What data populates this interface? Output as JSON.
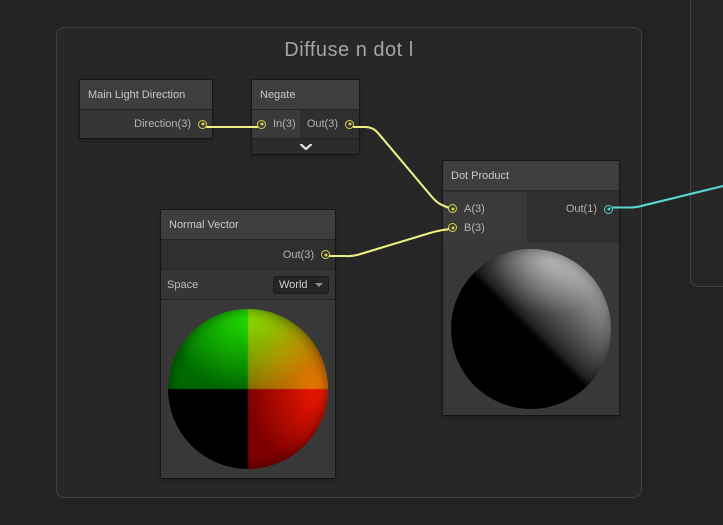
{
  "group": {
    "title": "Diffuse n dot l"
  },
  "nodes": {
    "main_light_direction": {
      "title": "Main Light Direction",
      "output_label": "Direction(3)"
    },
    "negate": {
      "title": "Negate",
      "input_label": "In(3)",
      "output_label": "Out(3)"
    },
    "normal_vector": {
      "title": "Normal Vector",
      "output_label": "Out(3)",
      "space_label": "Space",
      "space_value": "World"
    },
    "dot_product": {
      "title": "Dot Product",
      "input_a_label": "A(3)",
      "input_b_label": "B(3)",
      "output_label": "Out(1)"
    }
  },
  "colors": {
    "canvas_bg": "#232323",
    "group_border": "#404040",
    "node_title_bg": "#3e3e3e",
    "node_body_bg": "#2f2f2f",
    "input_cell_bg": "#3a3a3a",
    "vector3_port": "#d6d64a",
    "vector3_wire": "#edf183",
    "vector1_port": "#53d2ce",
    "vector1_wire": "#5ad6d2"
  }
}
